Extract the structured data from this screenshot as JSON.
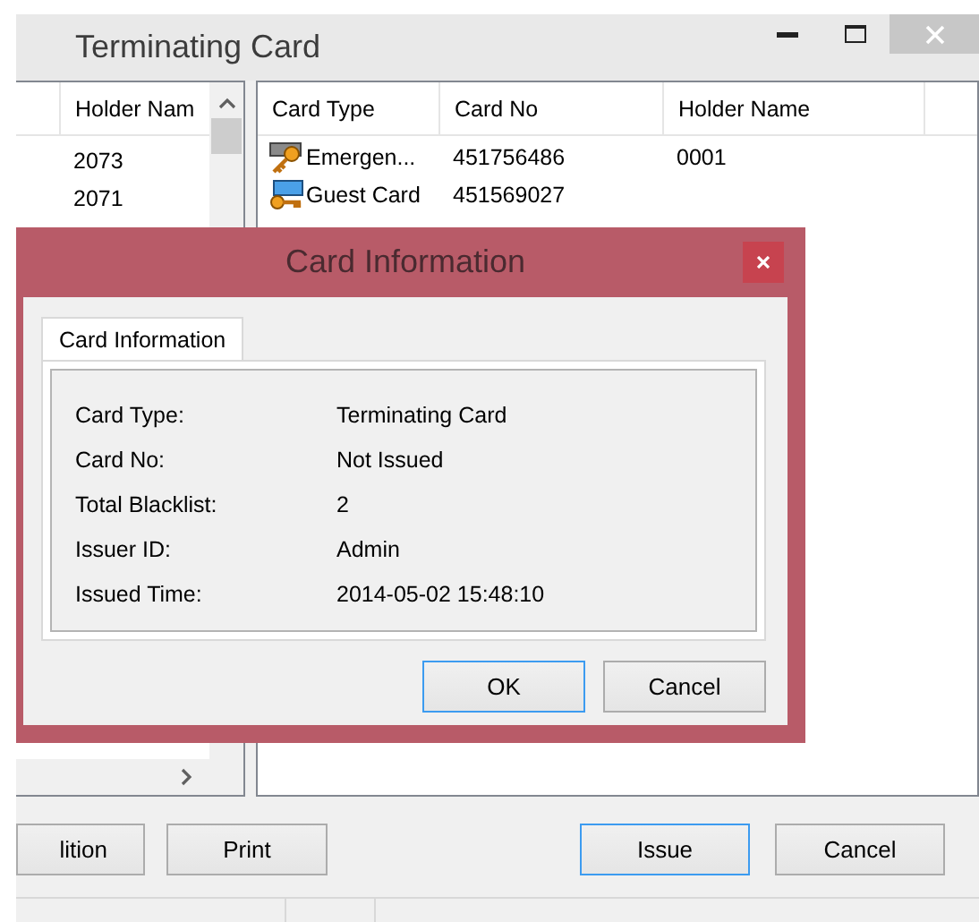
{
  "window": {
    "title": "Terminating Card"
  },
  "left_list": {
    "columns": [
      "Holder Nam"
    ],
    "rows": [
      "2073",
      "2071"
    ]
  },
  "card_table": {
    "columns": [
      "Card Type",
      "Card No",
      "Holder Name"
    ],
    "rows": [
      {
        "kind": "emergency",
        "card_type": "Emergen...",
        "card_no": "451756486",
        "holder_name": "0001"
      },
      {
        "kind": "guest",
        "card_type": "Guest Card",
        "card_no": "451569027"
      }
    ]
  },
  "buttons_left": [
    "lition",
    "Print"
  ],
  "buttons_right": [
    {
      "label": "Issue",
      "focused": true
    },
    {
      "label": "Cancel",
      "focused": false
    }
  ],
  "dialog": {
    "title": "Card Information",
    "tabs": [
      {
        "label": "Card Information",
        "selected": true
      }
    ],
    "fields": [
      {
        "label": "Card Type:",
        "value": "Terminating Card"
      },
      {
        "label": "Card No:",
        "value": "Not Issued"
      },
      {
        "label": "Total Blacklist:",
        "value": "2"
      },
      {
        "label": "Issuer ID:",
        "value": "Admin"
      },
      {
        "label": "Issued Time:",
        "value": "2014-05-02 15:48:10"
      }
    ],
    "buttons": [
      {
        "label": "OK",
        "focused": true
      },
      {
        "label": "Cancel",
        "focused": false
      }
    ]
  }
}
